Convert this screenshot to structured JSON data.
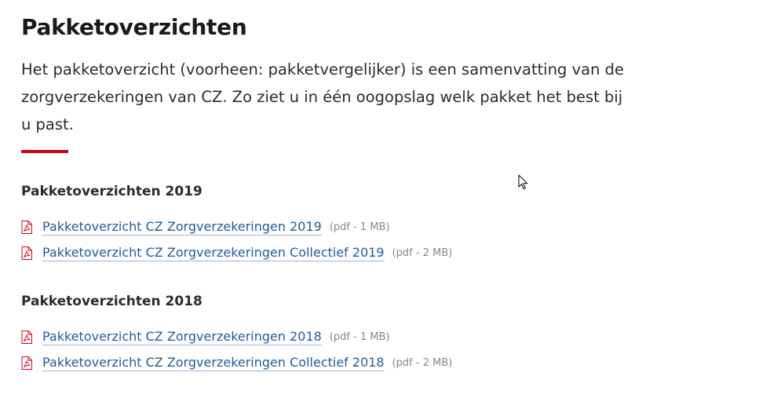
{
  "page": {
    "title": "Pakketoverzichten",
    "intro": "Het pakketoverzicht (voorheen: pakketvergelijker) is een samenvatting van de zorgverzekeringen van CZ. Zo ziet u in één oogopslag welk pakket het best bij u past."
  },
  "colors": {
    "accent": "#d0021b",
    "link": "#1f5c99",
    "pdf_icon": "#d0021b"
  },
  "sections": [
    {
      "heading": "Pakketoverzichten 2019",
      "documents": [
        {
          "icon": "pdf-icon",
          "label": "Pakketoverzicht CZ Zorgverzekeringen 2019",
          "meta": "(pdf - 1 MB)"
        },
        {
          "icon": "pdf-icon",
          "label": "Pakketoverzicht CZ Zorgverzekeringen Collectief 2019",
          "meta": "(pdf - 2 MB)"
        }
      ]
    },
    {
      "heading": "Pakketoverzichten 2018",
      "documents": [
        {
          "icon": "pdf-icon",
          "label": "Pakketoverzicht CZ Zorgverzekeringen 2018",
          "meta": "(pdf - 1 MB)"
        },
        {
          "icon": "pdf-icon",
          "label": "Pakketoverzicht CZ Zorgverzekeringen Collectief 2018",
          "meta": "(pdf - 2 MB)"
        }
      ]
    }
  ]
}
